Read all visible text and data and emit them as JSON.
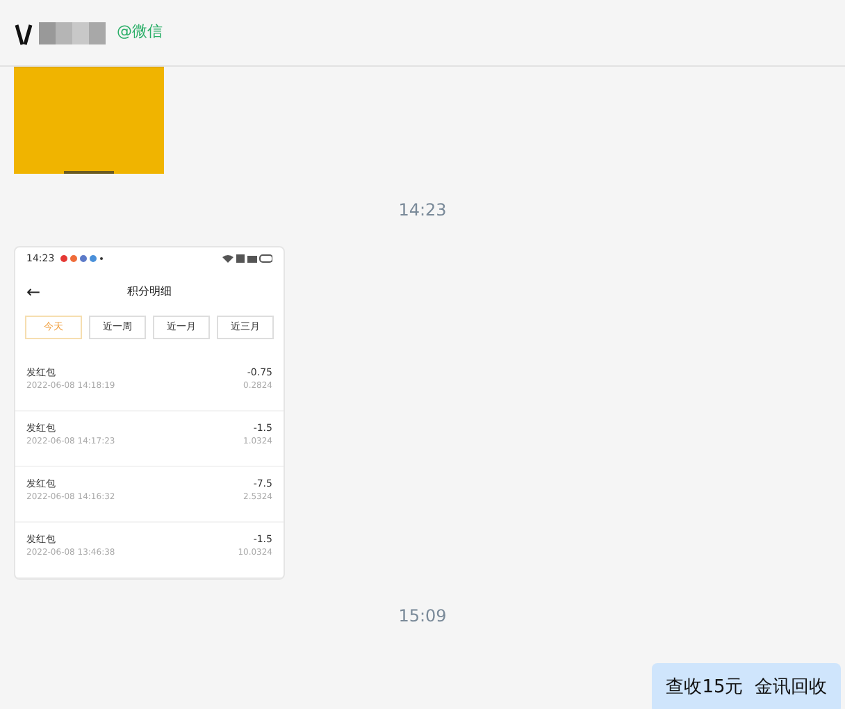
{
  "header": {
    "source": "@微信"
  },
  "messages": [
    {
      "kind": "picture"
    },
    {
      "kind": "time",
      "text": "14:23"
    },
    {
      "kind": "screenshot",
      "status_time": "14:23",
      "title": "积分明细",
      "back": "←",
      "tabs": [
        {
          "label": "今天",
          "selected": true
        },
        {
          "label": "近一周",
          "selected": false
        },
        {
          "label": "近一月",
          "selected": false
        },
        {
          "label": "近三月",
          "selected": false
        }
      ],
      "rows": [
        {
          "name": "发红包",
          "time": "2022-06-08 14:18:19",
          "amount": "-0.75",
          "balance": "0.2824"
        },
        {
          "name": "发红包",
          "time": "2022-06-08 14:17:23",
          "amount": "-1.5",
          "balance": "1.0324"
        },
        {
          "name": "发红包",
          "time": "2022-06-08 14:16:32",
          "amount": "-7.5",
          "balance": "2.5324"
        },
        {
          "name": "发红包",
          "time": "2022-06-08 13:46:38",
          "amount": "-1.5",
          "balance": "10.0324"
        }
      ]
    },
    {
      "kind": "time",
      "text": "15:09"
    },
    {
      "kind": "bubble",
      "text": "查收15元  金讯回收"
    }
  ]
}
